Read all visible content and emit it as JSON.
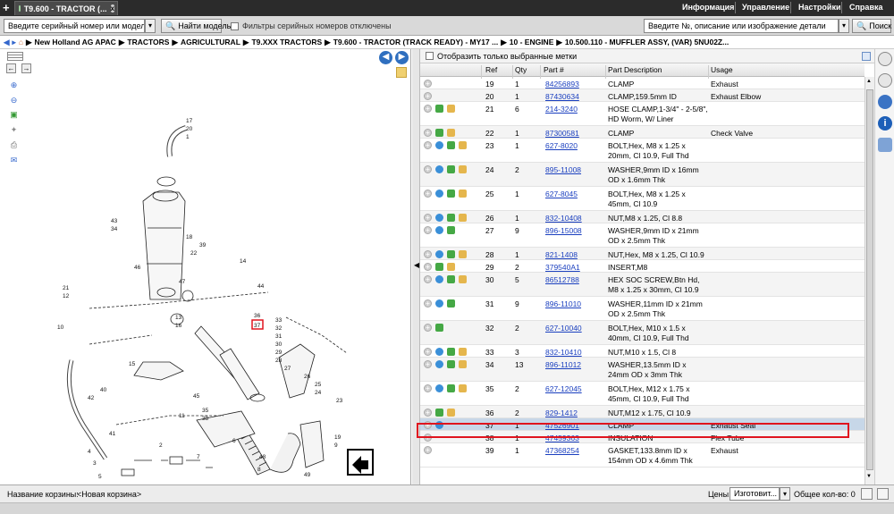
{
  "app": {
    "tab_title": "T9.600 - TRACTOR (...",
    "new_tab": "+",
    "close": "x"
  },
  "menu": [
    "Информация",
    "Управление",
    "Настройки",
    "Справка"
  ],
  "search": {
    "serial_placeholder": "Введите серийный номер или модель",
    "find_model_label": "Найти модель",
    "serial_filter_label": "Фильтры серийных номеров отключены",
    "part_search_placeholder": "Введите №, описание или изображение детали",
    "search_label": "Поиск"
  },
  "breadcrumb": [
    "New Holland AG APAC",
    "TRACTORS",
    "AGRICULTURAL",
    "T9.XXX TRACTORS",
    "T9.600 - TRACTOR (TRACK READY) - MY17 ...",
    "10 - ENGINE",
    "10.500.110 - MUFFLER ASSY, (VAR) 5NU02Z..."
  ],
  "filter": {
    "show_selected_label": "Отобразить только выбранные метки"
  },
  "columns": [
    "Ref",
    "Qty",
    "Part #",
    "Part Description",
    "Usage"
  ],
  "rows": [
    {
      "ref": "19",
      "qty": "1",
      "part": "84256893",
      "desc": "CLAMP",
      "usage": "Exhaust",
      "icons": []
    },
    {
      "ref": "20",
      "qty": "1",
      "part": "87430634",
      "desc": "CLAMP,159.5mm ID",
      "usage": "Exhaust Elbow",
      "icons": []
    },
    {
      "ref": "21",
      "qty": "6",
      "part": "214-3240",
      "desc": "HOSE CLAMP,1-3/4\" - 2-5/8\", HD Worm, W/ Liner",
      "usage": "",
      "icons": [
        "green",
        "box"
      ]
    },
    {
      "ref": "22",
      "qty": "1",
      "part": "87300581",
      "desc": "CLAMP",
      "usage": "Check Valve",
      "icons": [
        "green",
        "box"
      ]
    },
    {
      "ref": "23",
      "qty": "1",
      "part": "627-8020",
      "desc": "BOLT,Hex, M8 x 1.25 x 20mm, Cl 10.9, Full Thd",
      "usage": "",
      "icons": [
        "blue",
        "green",
        "box"
      ]
    },
    {
      "ref": "24",
      "qty": "2",
      "part": "895-11008",
      "desc": "WASHER,9mm ID x 16mm OD x 1.6mm Thk",
      "usage": "",
      "icons": [
        "blue",
        "green",
        "box"
      ]
    },
    {
      "ref": "25",
      "qty": "1",
      "part": "627-8045",
      "desc": "BOLT,Hex, M8 x 1.25 x 45mm, Cl 10.9",
      "usage": "",
      "icons": [
        "blue",
        "green",
        "box"
      ]
    },
    {
      "ref": "26",
      "qty": "1",
      "part": "832-10408",
      "desc": "NUT,M8 x 1.25, Cl 8.8",
      "usage": "",
      "icons": [
        "blue",
        "green",
        "box"
      ]
    },
    {
      "ref": "27",
      "qty": "9",
      "part": "896-15008",
      "desc": "WASHER,9mm ID x 21mm OD x 2.5mm Thk",
      "usage": "",
      "icons": [
        "blue",
        "green"
      ]
    },
    {
      "ref": "28",
      "qty": "1",
      "part": "821-1408",
      "desc": "NUT,Hex, M8 x 1.25, Cl 10.9",
      "usage": "",
      "icons": [
        "blue",
        "green",
        "box"
      ]
    },
    {
      "ref": "29",
      "qty": "2",
      "part": "379540A1",
      "desc": "INSERT,M8",
      "usage": "",
      "icons": [
        "green",
        "box"
      ]
    },
    {
      "ref": "30",
      "qty": "5",
      "part": "86512788",
      "desc": "HEX SOC SCREW,Btn Hd, M8 x 1.25 x 30mm, Cl 10.9",
      "usage": "",
      "icons": [
        "blue",
        "green",
        "box"
      ]
    },
    {
      "ref": "31",
      "qty": "9",
      "part": "896-11010",
      "desc": "WASHER,11mm ID x 21mm OD x 2.5mm Thk",
      "usage": "",
      "icons": [
        "blue",
        "green"
      ]
    },
    {
      "ref": "32",
      "qty": "2",
      "part": "627-10040",
      "desc": "BOLT,Hex, M10 x 1.5 x 40mm, Cl 10.9, Full Thd",
      "usage": "",
      "icons": [
        "green"
      ]
    },
    {
      "ref": "33",
      "qty": "3",
      "part": "832-10410",
      "desc": "NUT,M10 x 1.5, Cl 8",
      "usage": "",
      "icons": [
        "blue",
        "green",
        "box"
      ]
    },
    {
      "ref": "34",
      "qty": "13",
      "part": "896-11012",
      "desc": "WASHER,13.5mm ID x 24mm OD x 3mm Thk",
      "usage": "",
      "icons": [
        "blue",
        "green",
        "box"
      ]
    },
    {
      "ref": "35",
      "qty": "2",
      "part": "627-12045",
      "desc": "BOLT,Hex, M12 x 1.75 x 45mm, Cl 10.9, Full Thd",
      "usage": "",
      "icons": [
        "blue",
        "green",
        "box"
      ]
    },
    {
      "ref": "36",
      "qty": "2",
      "part": "829-1412",
      "desc": "NUT,M12 x 1.75, Cl 10.9",
      "usage": "",
      "icons": [
        "green",
        "box"
      ]
    },
    {
      "ref": "37",
      "qty": "1",
      "part": "47526901",
      "desc": "CLAMP",
      "usage": "Exhaust Seal",
      "icons": [
        "blue"
      ]
    },
    {
      "ref": "38",
      "qty": "1",
      "part": "47459363",
      "desc": "INSULATION",
      "usage": "Flex Tube",
      "icons": []
    },
    {
      "ref": "39",
      "qty": "1",
      "part": "47368254",
      "desc": "GASKET,133.8mm ID x 154mm OD x 4.6mm Thk",
      "usage": "Exhaust",
      "icons": []
    }
  ],
  "diagram_labels": [
    "17",
    "20",
    "1",
    "43",
    "34",
    "18",
    "39",
    "22",
    "46",
    "47",
    "14",
    "44",
    "21",
    "12",
    "13",
    "16",
    "10",
    "36",
    "37",
    "33",
    "32",
    "31",
    "30",
    "29",
    "28",
    "27",
    "26",
    "25",
    "24",
    "23",
    "48",
    "8",
    "6",
    "19",
    "9",
    "49",
    "40",
    "42",
    "41",
    "2",
    "3",
    "5",
    "7",
    "4",
    "11",
    "45",
    "35",
    "38",
    "15"
  ],
  "status": {
    "basket_label": "Название корзины:",
    "basket_value": "<Новая корзина>",
    "prices_label": "Цены:",
    "prices_value": "Изготовит...",
    "total_label": "Общее кол-во: 0"
  },
  "colors": {
    "highlight": "#e0141e",
    "selected_row": "#c7d7e8",
    "link": "#1a3fbf"
  }
}
